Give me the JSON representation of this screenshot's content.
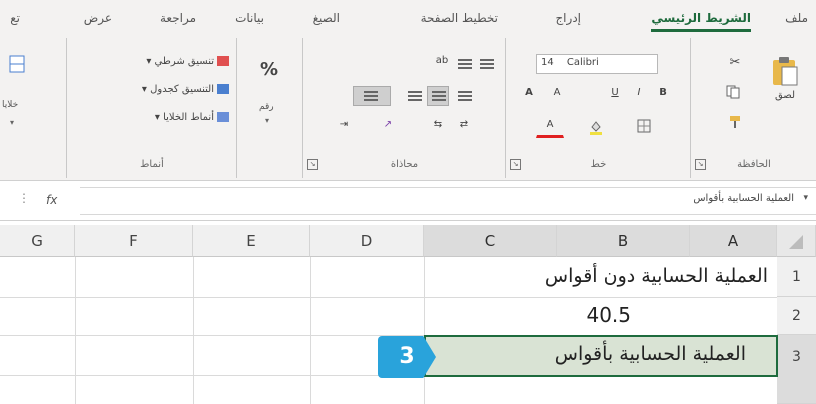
{
  "tabs": {
    "file": "ملف",
    "home": "الشريط الرئيسي",
    "insert": "إدراج",
    "page_layout": "تخطيط الصفحة",
    "formulas": "الصيغ",
    "data": "بيانات",
    "review": "مراجعة",
    "view": "عرض",
    "partial": "تع"
  },
  "ribbon": {
    "clipboard": {
      "paste": "لصق",
      "label": "الحافظة"
    },
    "font": {
      "name": "Calibri",
      "size": "14",
      "label": "خط",
      "bold": "B",
      "italic": "I",
      "underline": "U",
      "grow": "A",
      "shrink": "A",
      "font_color_letter": "A"
    },
    "alignment": {
      "label": "محاذاة"
    },
    "number": {
      "percent": "%",
      "label": "رقم"
    },
    "styles": {
      "conditional": "تنسيق شرطي",
      "table": "التنسيق كجدول",
      "cell_styles": "أنماط الخلايا",
      "label": "أنماط"
    },
    "cells": {
      "label": "خلايا"
    }
  },
  "formula_bar": {
    "name_box": "العملية الحسابية بأقواس",
    "fx": "fx"
  },
  "grid": {
    "columns": [
      "A",
      "B",
      "C",
      "D",
      "E",
      "F",
      "G"
    ],
    "rows": [
      "1",
      "2",
      "3"
    ],
    "cells": {
      "r1": "العملية الحسابية دون أقواس",
      "r2": "40.5",
      "r3": "العملية الحسابية بأقواس"
    }
  },
  "callout": {
    "number": "3"
  },
  "colors": {
    "accent": "#1e6b3d",
    "badge": "#29a3db",
    "selection_fill": "#d9e3d4"
  }
}
